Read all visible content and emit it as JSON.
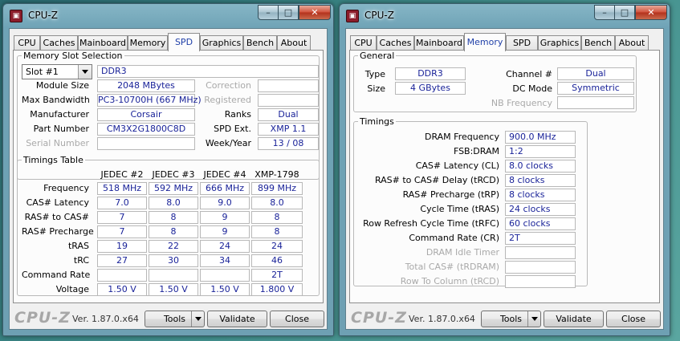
{
  "left_window": {
    "title": "CPU-Z",
    "app_icon": "cpuz-icon",
    "window_controls": {
      "minimize": "–",
      "maximize": "□",
      "close": "✕"
    },
    "tabs": [
      "CPU",
      "Caches",
      "Mainboard",
      "Memory",
      "SPD",
      "Graphics",
      "Bench",
      "About"
    ],
    "active_tab": "SPD",
    "slot_group": {
      "legend": "Memory Slot Selection",
      "slot_selected": "Slot #1",
      "memory_type": "DDR3",
      "module_size_label": "Module Size",
      "module_size": "2048 MBytes",
      "max_bandwidth_label": "Max Bandwidth",
      "max_bandwidth": "PC3-10700H (667 MHz)",
      "manufacturer_label": "Manufacturer",
      "manufacturer": "Corsair",
      "part_number_label": "Part Number",
      "part_number": "CM3X2G1800C8D",
      "serial_number_label": "Serial Number",
      "serial_number": "",
      "correction_label": "Correction",
      "correction": "",
      "registered_label": "Registered",
      "registered": "",
      "ranks_label": "Ranks",
      "ranks": "Dual",
      "spd_ext_label": "SPD Ext.",
      "spd_ext": "XMP 1.1",
      "week_year_label": "Week/Year",
      "week_year": "13 / 08"
    },
    "timings_table": {
      "legend": "Timings Table",
      "columns": [
        "JEDEC #2",
        "JEDEC #3",
        "JEDEC #4",
        "XMP-1798"
      ],
      "rows": [
        {
          "label": "Frequency",
          "values": [
            "518 MHz",
            "592 MHz",
            "666 MHz",
            "899 MHz"
          ]
        },
        {
          "label": "CAS# Latency",
          "values": [
            "7.0",
            "8.0",
            "9.0",
            "8.0"
          ]
        },
        {
          "label": "RAS# to CAS#",
          "values": [
            "7",
            "8",
            "9",
            "8"
          ]
        },
        {
          "label": "RAS# Precharge",
          "values": [
            "7",
            "8",
            "9",
            "8"
          ]
        },
        {
          "label": "tRAS",
          "values": [
            "19",
            "22",
            "24",
            "24"
          ]
        },
        {
          "label": "tRC",
          "values": [
            "27",
            "30",
            "34",
            "46"
          ]
        },
        {
          "label": "Command Rate",
          "values": [
            "",
            "",
            "",
            "2T"
          ]
        },
        {
          "label": "Voltage",
          "values": [
            "1.50 V",
            "1.50 V",
            "1.50 V",
            "1.800 V"
          ]
        }
      ]
    },
    "footer": {
      "brand": "CPU-Z",
      "version": "Ver. 1.87.0.x64",
      "tools": "Tools",
      "validate": "Validate",
      "close": "Close"
    }
  },
  "right_window": {
    "title": "CPU-Z",
    "app_icon": "cpuz-icon",
    "window_controls": {
      "minimize": "–",
      "maximize": "□",
      "close": "✕"
    },
    "tabs": [
      "CPU",
      "Caches",
      "Mainboard",
      "Memory",
      "SPD",
      "Graphics",
      "Bench",
      "About"
    ],
    "active_tab": "Memory",
    "general": {
      "legend": "General",
      "type_label": "Type",
      "type": "DDR3",
      "size_label": "Size",
      "size": "4 GBytes",
      "channel_label": "Channel #",
      "channel": "Dual",
      "dc_mode_label": "DC Mode",
      "dc_mode": "Symmetric",
      "nb_frequency_label": "NB Frequency",
      "nb_frequency": ""
    },
    "timings": {
      "legend": "Timings",
      "rows": [
        {
          "label": "DRAM Frequency",
          "value": "900.0 MHz",
          "dim": false
        },
        {
          "label": "FSB:DRAM",
          "value": "1:2",
          "dim": false
        },
        {
          "label": "CAS# Latency (CL)",
          "value": "8.0 clocks",
          "dim": false
        },
        {
          "label": "RAS# to CAS# Delay (tRCD)",
          "value": "8 clocks",
          "dim": false
        },
        {
          "label": "RAS# Precharge (tRP)",
          "value": "8 clocks",
          "dim": false
        },
        {
          "label": "Cycle Time (tRAS)",
          "value": "24 clocks",
          "dim": false
        },
        {
          "label": "Row Refresh Cycle Time (tRFC)",
          "value": "60 clocks",
          "dim": false
        },
        {
          "label": "Command Rate (CR)",
          "value": "2T",
          "dim": false
        },
        {
          "label": "DRAM Idle Timer",
          "value": "",
          "dim": true
        },
        {
          "label": "Total CAS# (tRDRAM)",
          "value": "",
          "dim": true
        },
        {
          "label": "Row To Column (tRCD)",
          "value": "",
          "dim": true
        }
      ]
    },
    "footer": {
      "brand": "CPU-Z",
      "version": "Ver. 1.87.0.x64",
      "tools": "Tools",
      "validate": "Validate",
      "close": "Close"
    }
  },
  "colors": {
    "value_text": "#1a2399",
    "active_tab_text": "#1f3fa8",
    "dim_label": "#a9a9a9",
    "window_frame": "#6fa3b6"
  }
}
